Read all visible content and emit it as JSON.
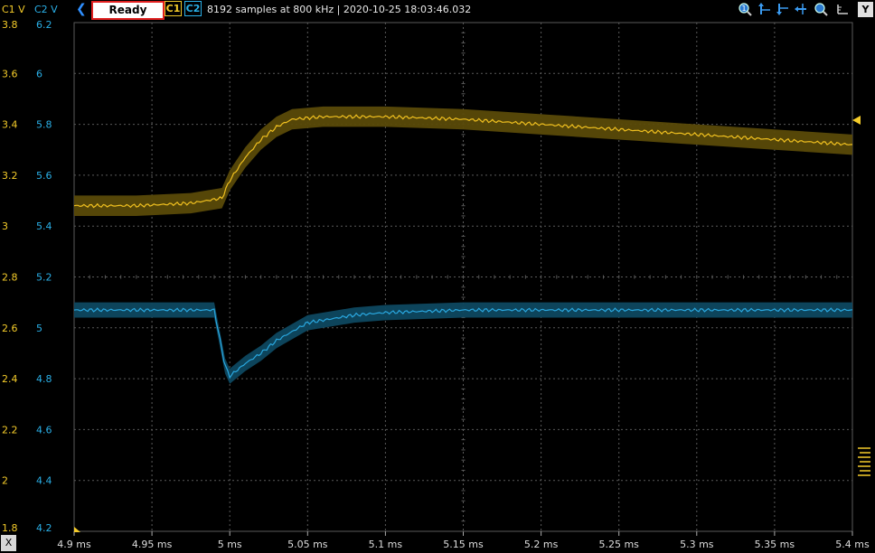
{
  "header": {
    "c1_axis_label": "C1 V",
    "c2_axis_label": "C2 V",
    "status": "Ready",
    "c1_button": "C1",
    "c2_button": "C2",
    "info": "8192 samples at 800 kHz | 2020-10-25 18:03:46.032",
    "y_button": "Y",
    "x_button": "X",
    "tools": [
      "zoom-reset-icon",
      "cursor-up-icon",
      "cursor-down-icon",
      "cursor-left-icon",
      "zoom-icon"
    ]
  },
  "colors": {
    "c1": "#f0c020",
    "c2": "#2aa8e0",
    "c1_band": "#5a4a08",
    "c2_band": "#0e4860",
    "grid": "#5a5a5a"
  },
  "chart_data": {
    "type": "line",
    "x_unit": "ms",
    "xlim": [
      4.9,
      5.4
    ],
    "x_ticks": [
      "4.9 ms",
      "4.95 ms",
      "5 ms",
      "5.05 ms",
      "5.1 ms",
      "5.15 ms",
      "5.2 ms",
      "5.25 ms",
      "5.3 ms",
      "5.35 ms",
      "5.4 ms"
    ],
    "c1_ylim": [
      1.8,
      3.8
    ],
    "c1_ticks": [
      "3.8",
      "3.6",
      "3.4",
      "3.2",
      "3",
      "2.8",
      "2.6",
      "2.4",
      "2.2",
      "2",
      "1.8"
    ],
    "c2_ylim": [
      4.2,
      6.2
    ],
    "c2_ticks": [
      "6.2",
      "6",
      "5.8",
      "5.6",
      "5.4",
      "5.2",
      "5",
      "4.8",
      "4.6",
      "4.4",
      "4.2"
    ],
    "series": [
      {
        "channel": "C1",
        "x": [
          4.9,
          4.94,
          4.975,
          4.995,
          5.0,
          5.01,
          5.02,
          5.03,
          5.04,
          5.06,
          5.1,
          5.15,
          5.2,
          5.25,
          5.3,
          5.35,
          5.4
        ],
        "y": [
          3.08,
          3.08,
          3.09,
          3.11,
          3.18,
          3.27,
          3.34,
          3.39,
          3.42,
          3.43,
          3.43,
          3.42,
          3.4,
          3.38,
          3.36,
          3.34,
          3.32
        ],
        "band_halfwidth": 0.04
      },
      {
        "channel": "C2",
        "x": [
          4.9,
          4.93,
          4.97,
          4.99,
          4.997,
          5.0,
          5.01,
          5.02,
          5.03,
          5.05,
          5.08,
          5.1,
          5.15,
          5.2,
          5.3,
          5.4
        ],
        "y": [
          5.07,
          5.07,
          5.07,
          5.07,
          4.85,
          4.81,
          4.86,
          4.9,
          4.95,
          5.02,
          5.05,
          5.06,
          5.07,
          5.07,
          5.07,
          5.07
        ],
        "band_halfwidth": 0.03
      }
    ]
  }
}
